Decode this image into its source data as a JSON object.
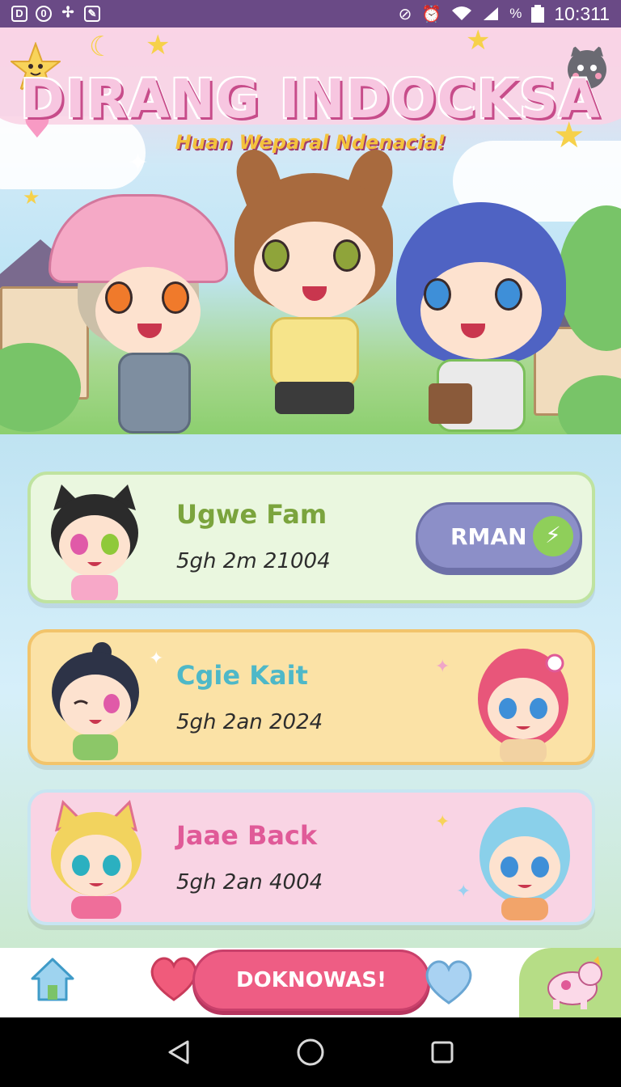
{
  "status_bar": {
    "time": "10:311",
    "battery_text": "%",
    "left_icons": [
      "notification-d-icon",
      "notification-0-icon",
      "notification-fan-icon",
      "notification-edit-icon"
    ],
    "right_icons": [
      "no-sim-icon",
      "alarm-icon",
      "wifi-icon",
      "signal-icon",
      "battery-icon"
    ]
  },
  "header": {
    "title": "DIRANG INDOCKSA",
    "subtitle": "Huan Weparal Ndenacia!"
  },
  "cards": [
    {
      "name": "Ugwe Fam",
      "date": "5gh 2m 21004",
      "button_label": "RMAN"
    },
    {
      "name": "Cgie Kait",
      "date": "5gh 2an 2024"
    },
    {
      "name": "Jaae Back",
      "date": "5gh 2an 4004"
    }
  ],
  "action_bar": {
    "download_label": "DOKNOWAS!"
  },
  "colors": {
    "status_bar": "#6a4a86",
    "download_button": "#ee5d84",
    "rman_button": "#8c8fc8"
  }
}
